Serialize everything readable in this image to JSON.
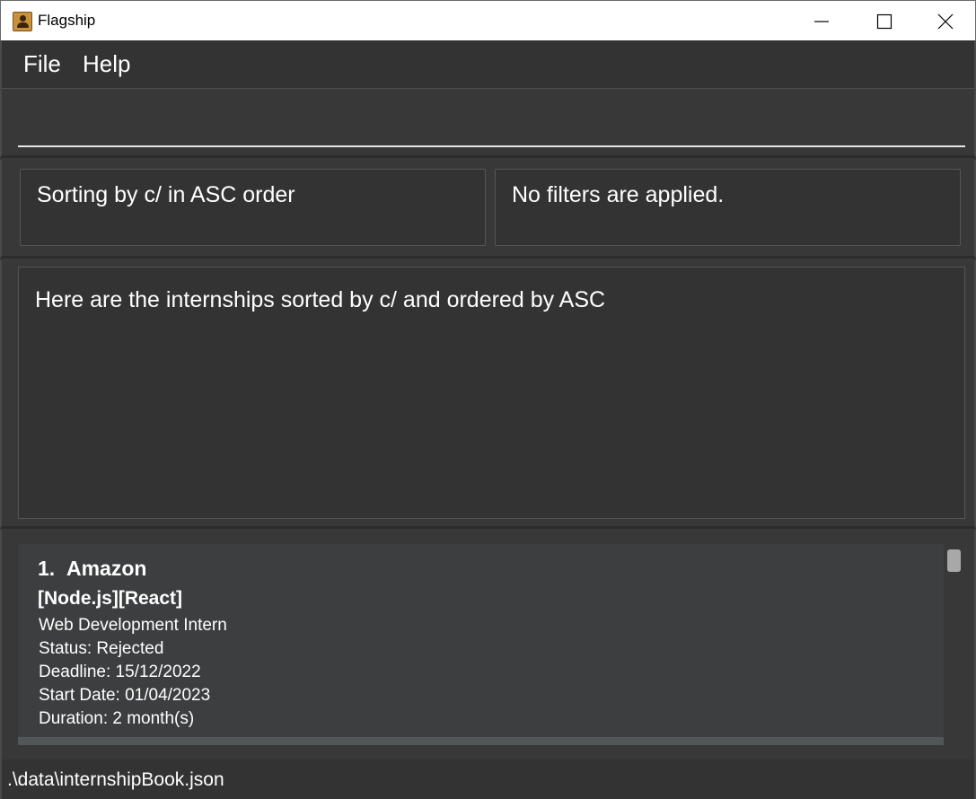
{
  "window": {
    "title": "Flagship",
    "icon": "address-book-icon"
  },
  "menu": {
    "file_label": "File",
    "help_label": "Help"
  },
  "command": {
    "value": "",
    "placeholder": ""
  },
  "sort_status": "Sorting by c/ in ASC order",
  "filter_status": "No filters are applied.",
  "result_message": "Here are the internships sorted by c/ and ordered by ASC",
  "internships": [
    {
      "index": "1.",
      "company": "Amazon",
      "tags": "[Node.js][React]",
      "role": "Web Development Intern",
      "status": "Status: Rejected",
      "deadline": "Deadline: 15/12/2022",
      "start_date": "Start Date: 01/04/2023",
      "duration": "Duration: 2 month(s)"
    }
  ],
  "statusbar": {
    "path": ".\\data\\internshipBook.json"
  },
  "colors": {
    "background": "#3a3a3a",
    "panel": "#333333",
    "card": "#3c3e3f",
    "text": "#ffffff"
  }
}
